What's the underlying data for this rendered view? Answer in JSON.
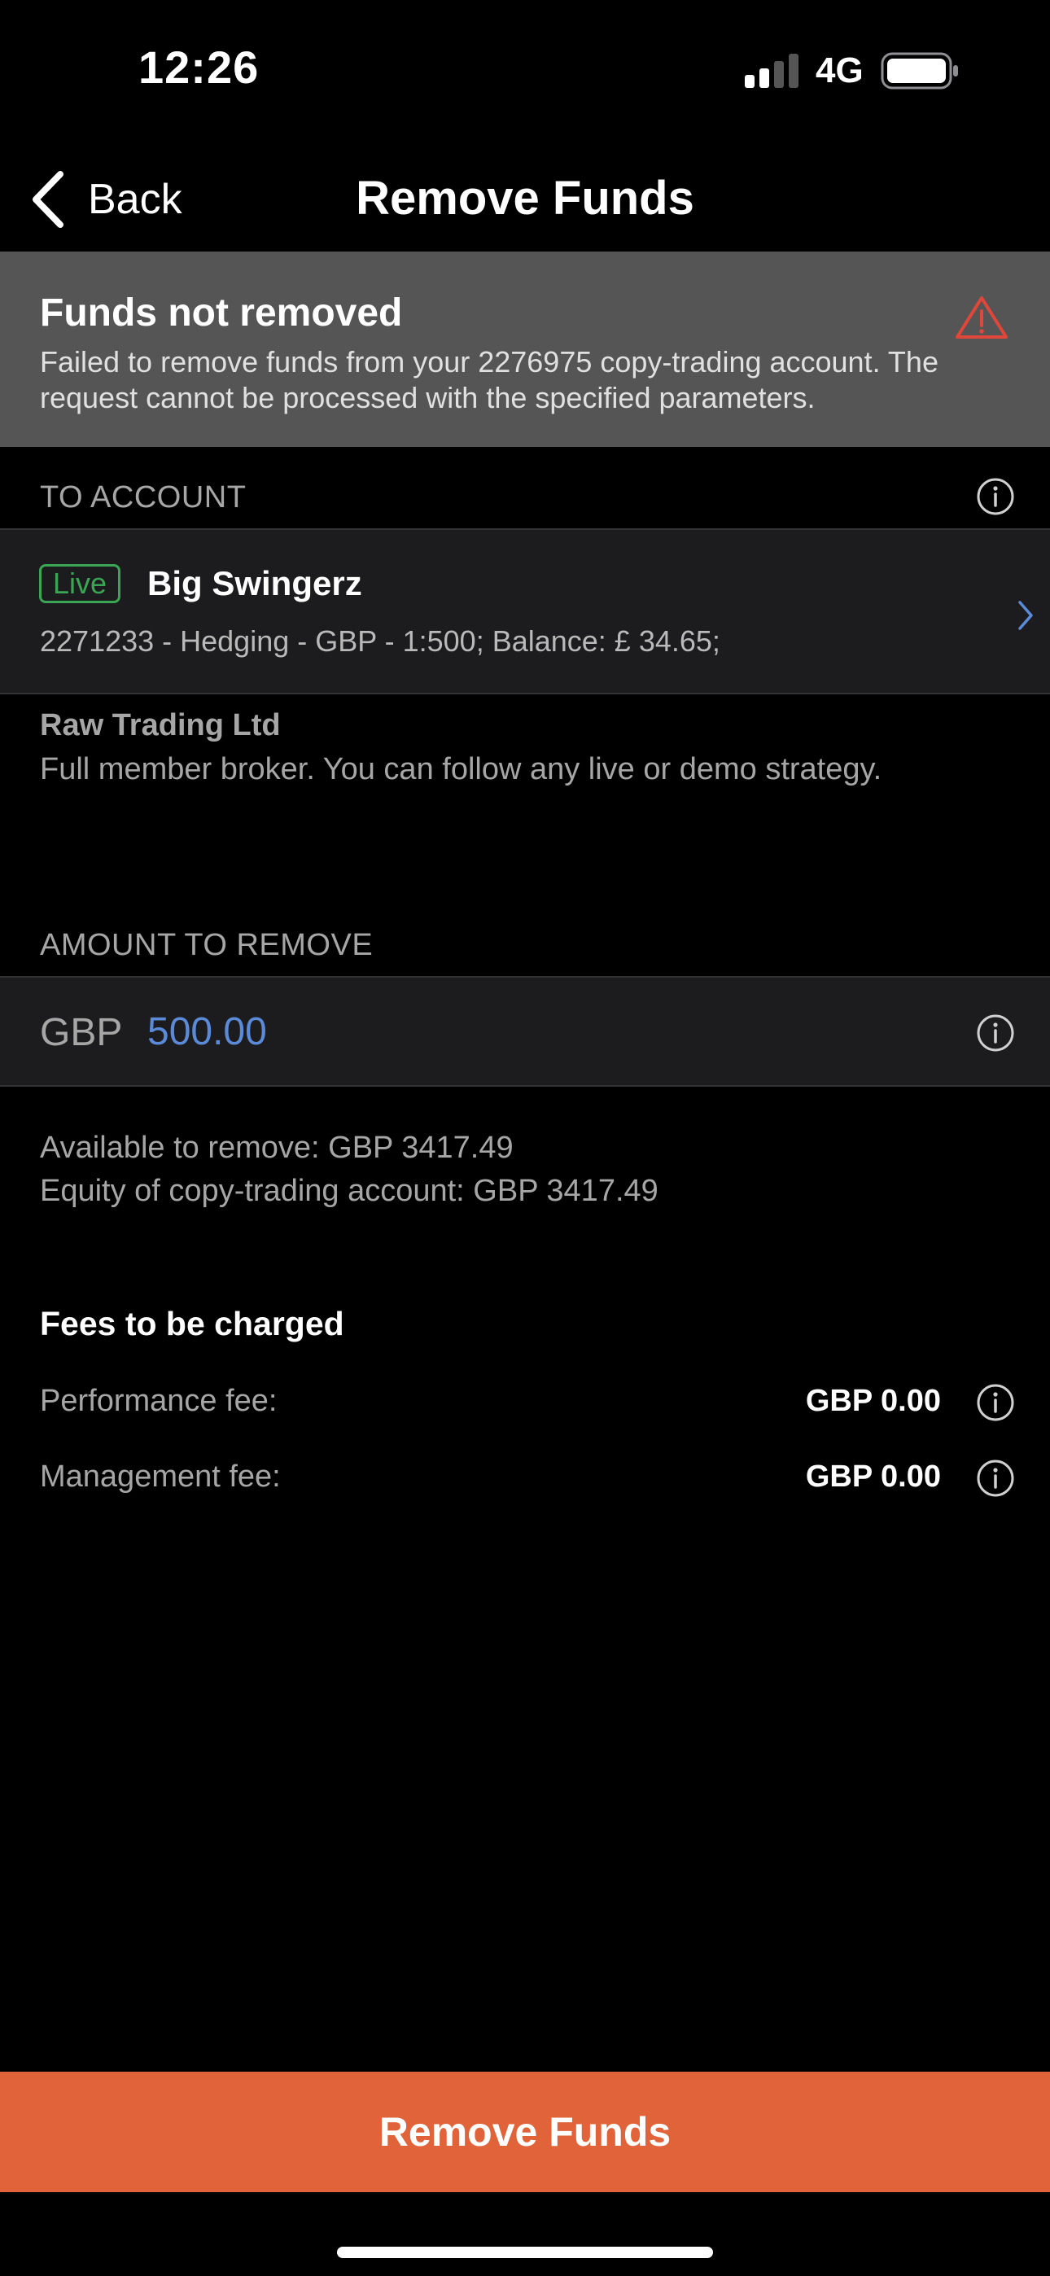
{
  "status_bar": {
    "time": "12:26",
    "network": "4G",
    "icons": [
      "signal-icon",
      "battery-icon"
    ]
  },
  "nav": {
    "back_label": "Back",
    "title": "Remove Funds"
  },
  "banner": {
    "title": "Funds not removed",
    "message": "Failed to remove funds from your 2276975 copy-trading account. The request cannot be processed with the specified parameters.",
    "icon": "warning-icon",
    "color": "#555555",
    "icon_color": "#e0463a"
  },
  "to_account": {
    "label": "TO ACCOUNT",
    "badge": "Live",
    "name": "Big Swingerz",
    "details": "2271233 - Hedging - GBP - 1:500; Balance: £ 34.65;"
  },
  "broker": {
    "name": "Raw Trading Ltd",
    "description": "Full member broker. You can follow any live or demo strategy."
  },
  "amount": {
    "label": "AMOUNT TO REMOVE",
    "currency": "GBP",
    "value": "500.00",
    "available": "Available to remove: GBP 3417.49",
    "equity": "Equity of copy-trading account: GBP 3417.49"
  },
  "fees": {
    "title": "Fees to be charged",
    "items": [
      {
        "label": "Performance fee:",
        "value": "GBP 0.00"
      },
      {
        "label": "Management fee:",
        "value": "GBP 0.00"
      }
    ]
  },
  "cta": {
    "label": "Remove Funds",
    "color": "#e0633a"
  },
  "colors": {
    "accent": "#5b8bd8",
    "live": "#3aa655"
  }
}
